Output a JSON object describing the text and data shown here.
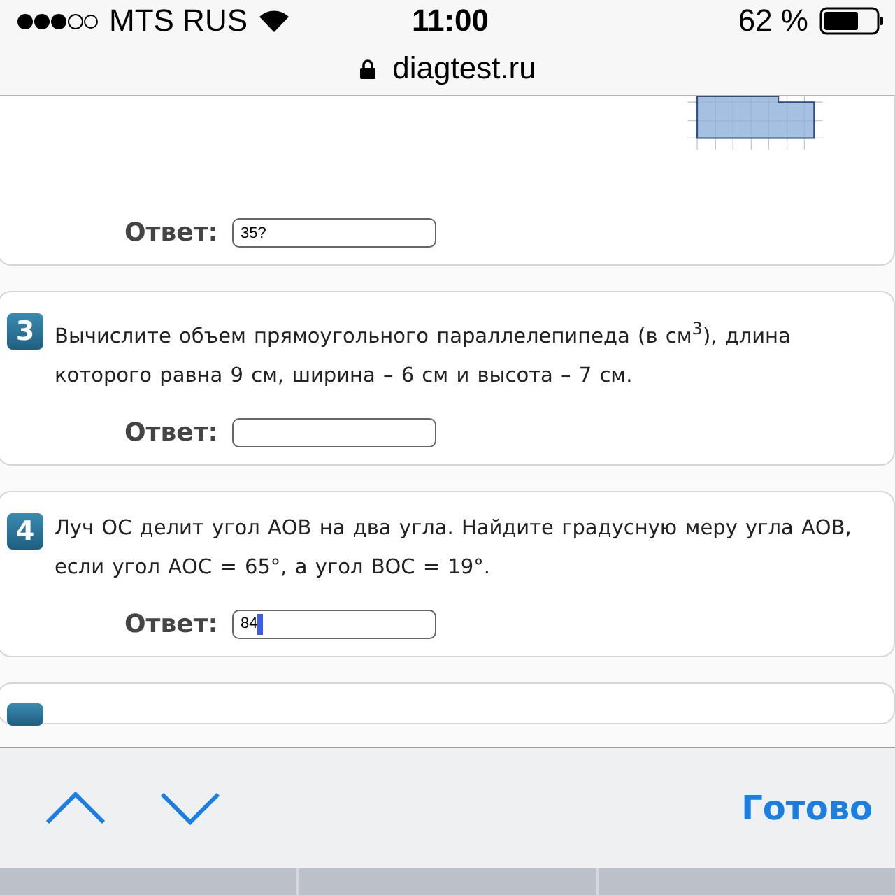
{
  "status_bar": {
    "carrier": "MTS RUS",
    "time": "11:00",
    "battery": "62 %"
  },
  "address_bar": {
    "url": "diagtest.ru",
    "secure": true
  },
  "questions": [
    {
      "kind": "partial",
      "answer_label": "Ответ:",
      "answer": "35?",
      "focused": false
    },
    {
      "kind": "full",
      "number": "3",
      "text": "Вычислите объем прямоугольного параллелепипеда (в см$^{3}$),  длина которого равна 9 см, ширина – 6 см и высота – 7 см.",
      "answer_label": "Ответ:",
      "focused": false
    },
    {
      "kind": "full",
      "number": "4",
      "text": "Луч ОС делит угол АОВ на два угла. Найдите градусную меру угла АОВ, если угол АОС = 65°, а угол ВОС = 19°.",
      "answer_label": "Ответ:",
      "answer": "84",
      "focused": true
    },
    {
      "kind": "cut"
    }
  ],
  "toolbar": {
    "done": "Готово"
  }
}
